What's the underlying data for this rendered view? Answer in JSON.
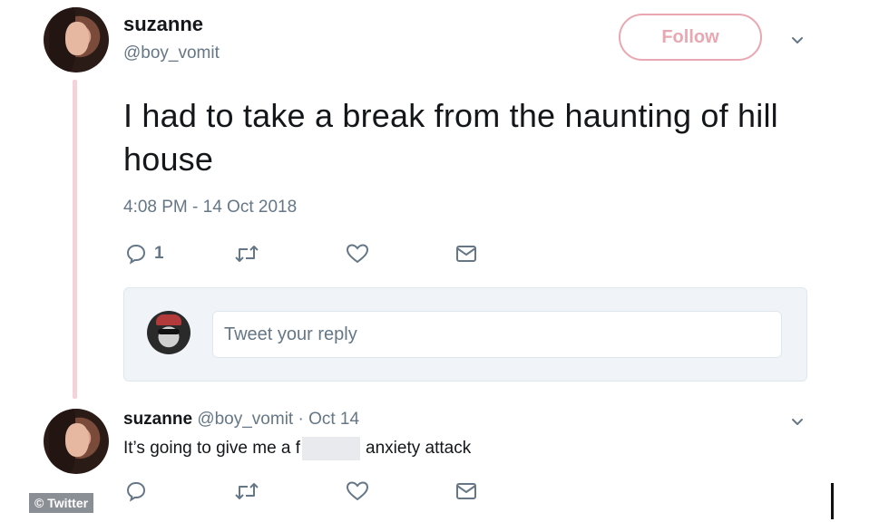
{
  "tweet": {
    "author": {
      "name": "suzanne",
      "handle": "@boy_vomit"
    },
    "follow_label": "Follow",
    "text": "I had to take a break from the haunting of hill house",
    "timestamp": "4:08 PM - 14 Oct 2018",
    "actions": {
      "reply_count": "1"
    },
    "reply_placeholder": "Tweet your reply"
  },
  "reply": {
    "name": "suzanne",
    "handle": "@boy_vomit",
    "separator": "·",
    "date": "Oct 14",
    "text_before": "It’s going to give me a f",
    "text_after": "anxiety attack"
  },
  "watermark": "© Twitter",
  "colors": {
    "follow": "#e8a7b1",
    "thread_line": "#f5d1d8",
    "muted": "#657786"
  }
}
